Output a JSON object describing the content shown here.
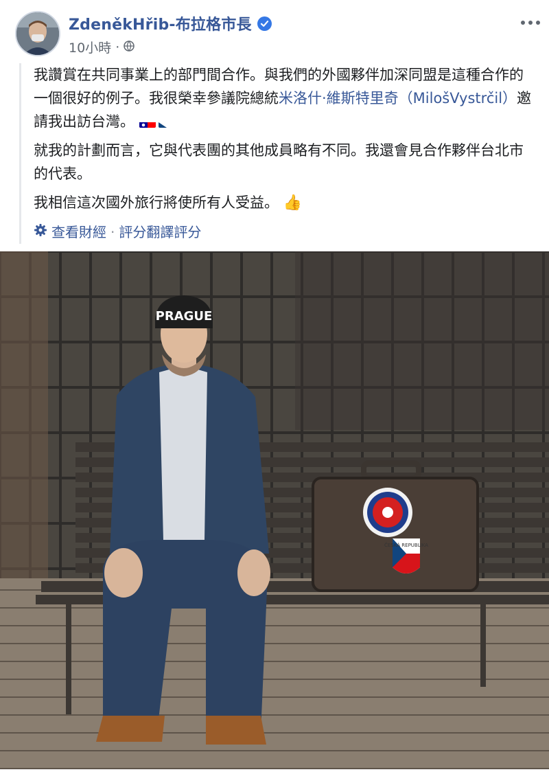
{
  "post": {
    "author": "ZdeněkHřib-布拉格市長",
    "time": "10小時",
    "paragraph1_a": "我讚賞在共同事業上的部門間合作。與我們的外國夥伴加深同盟是這種合作的一個很好的例子。我很榮幸參議院總統",
    "paragraph1_link": "米洛什·維斯特里奇（MilošVystrčil）",
    "paragraph1_b": "邀請我出訪台灣。",
    "paragraph2": "就我的計劃而言，它與代表團的其他成員略有不同。我還會見合作夥伴台北市的代表。",
    "paragraph3": "我相信這次國外旅行將使所有人受益。",
    "thumb_emoji": "👍",
    "see_original": "查看財經",
    "separator": "·",
    "rate_translation": "評分翻譯評分"
  },
  "photo": {
    "cap_text": "PRAGUE",
    "sticker_czech": "ČESKÁ REPUBLIKA"
  },
  "colors": {
    "link": "#385898",
    "verified": "#3578e5",
    "meta": "#606770"
  }
}
